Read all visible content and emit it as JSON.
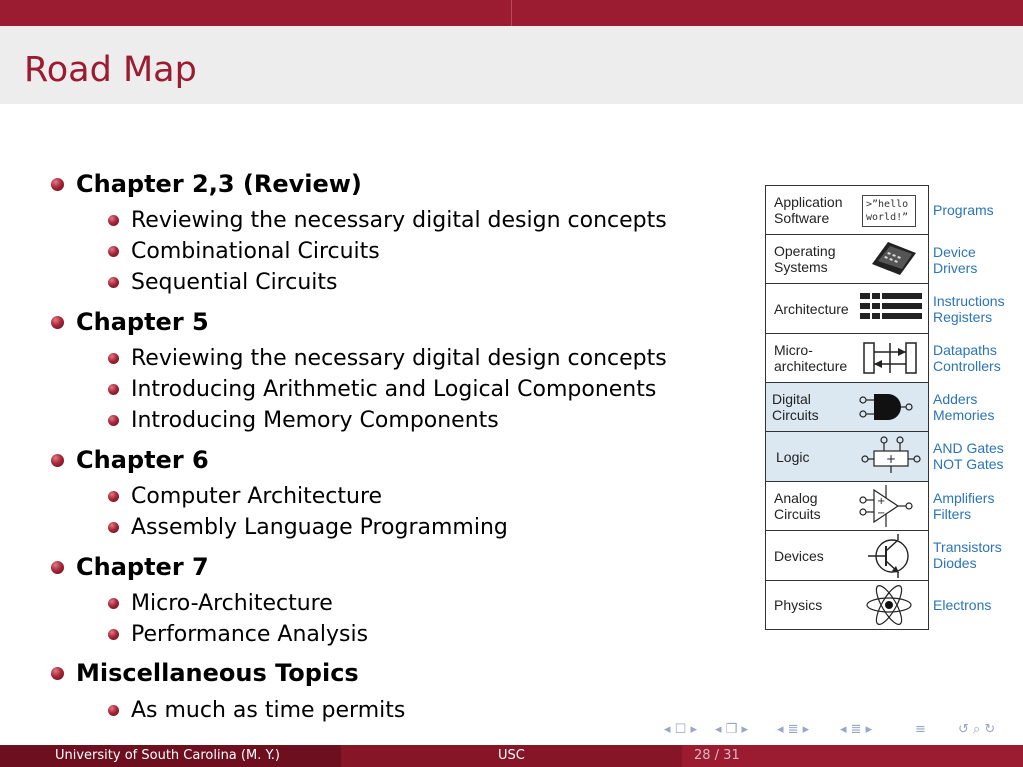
{
  "slide": {
    "title": "Road Map",
    "items": [
      {
        "label": "Chapter 2,3 (Review)",
        "subs": [
          "Reviewing the necessary digital design concepts",
          "Combinational Circuits",
          "Sequential Circuits"
        ]
      },
      {
        "label": "Chapter 5",
        "subs": [
          "Reviewing the necessary digital design concepts",
          "Introducing Arithmetic and Logical Components",
          "Introducing Memory Components"
        ]
      },
      {
        "label": "Chapter 6",
        "subs": [
          "Computer Architecture",
          "Assembly Language Programming"
        ]
      },
      {
        "label": "Chapter 7",
        "subs": [
          "Micro-Architecture",
          "Performance Analysis"
        ]
      },
      {
        "label": "Miscellaneous Topics",
        "subs": [
          "As much as time permits"
        ]
      }
    ]
  },
  "diagram": {
    "rows": [
      {
        "level": "Application\nSoftware",
        "right": "Programs",
        "icon": "hello-world-icon",
        "code": ">”hello\nworld!”"
      },
      {
        "level": "Operating\nSystems",
        "right": "Device\nDrivers",
        "icon": "laptop-icon"
      },
      {
        "level": "Architecture",
        "right": "Instructions\nRegisters",
        "icon": "instruction-blocks-icon"
      },
      {
        "level": "Micro-\narchitecture",
        "right": "Datapaths\nControllers",
        "icon": "datapath-icon"
      },
      {
        "level": "Digital\nCircuits",
        "right": "Adders\nMemories",
        "icon": "and-gate-icon"
      },
      {
        "level": "Logic",
        "right": "AND Gates\nNOT Gates",
        "icon": "logic-box-icon"
      },
      {
        "level": "Analog\nCircuits",
        "right": "Amplifiers\nFilters",
        "icon": "amplifier-icon"
      },
      {
        "level": "Devices",
        "right": "Transistors\nDiodes",
        "icon": "transistor-icon"
      },
      {
        "level": "Physics",
        "right": "Electrons",
        "icon": "atom-icon"
      }
    ]
  },
  "footer": {
    "left": "University of South Carolina  (M. Y.)",
    "center": "USC",
    "page": "28 / 31"
  },
  "colors": {
    "accent": "#9b1b30",
    "link": "#2a74b8",
    "shade": "#dbe8f1"
  }
}
